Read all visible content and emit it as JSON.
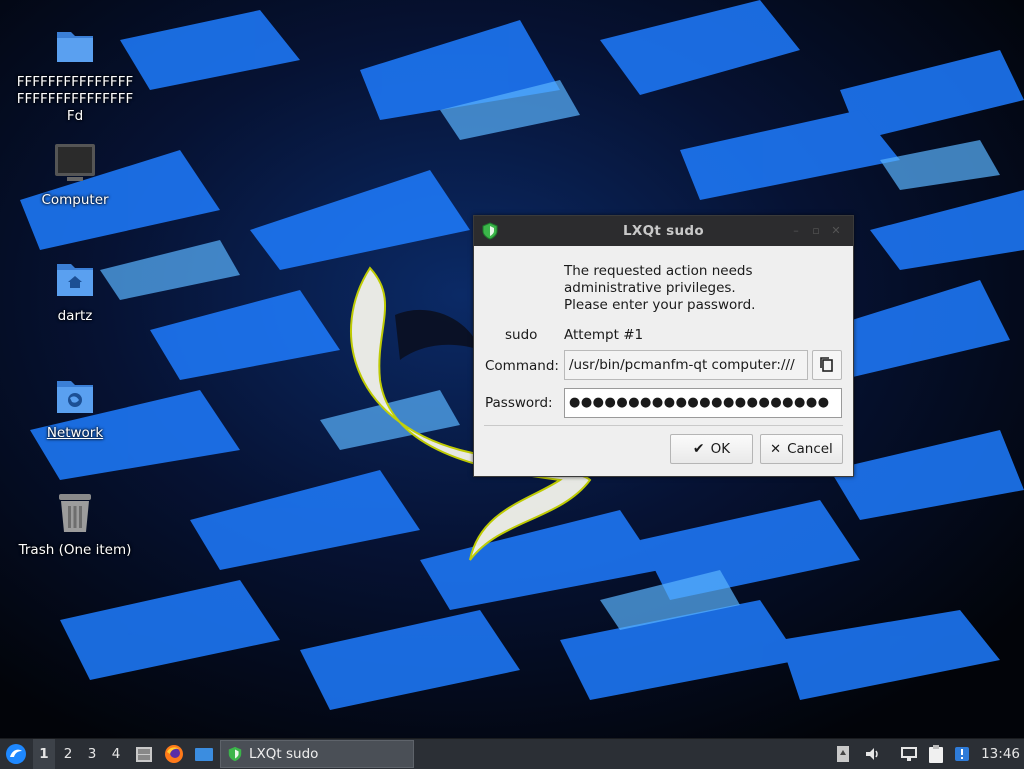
{
  "desktop": {
    "icons": [
      {
        "label": "FFFFFFFFFFFFFFFFFFFFFFFFFFFFFFFd",
        "icon": "folder-icon"
      },
      {
        "label": "Computer",
        "icon": "computer-icon"
      },
      {
        "label": "dartz",
        "icon": "home-folder-icon"
      },
      {
        "label": "Network",
        "icon": "network-folder-icon"
      },
      {
        "label": "Trash (One item)",
        "icon": "trash-icon"
      }
    ]
  },
  "dialog": {
    "title": "LXQt sudo",
    "message_line1": "The requested action needs",
    "message_line2": "administrative privileges.",
    "message_line3": "Please enter your password.",
    "sudo_label": "sudo",
    "attempt": "Attempt #1",
    "command_label": "Command:",
    "command_value": "/usr/bin/pcmanfm-qt computer:///",
    "password_label": "Password:",
    "password_mask": "●●●●●●●●●●●●●●●●●●●●●●",
    "ok_label": "OK",
    "cancel_label": "Cancel"
  },
  "taskbar": {
    "workspaces": [
      "1",
      "2",
      "3",
      "4"
    ],
    "active_workspace": "1",
    "task_label": "LXQt sudo",
    "clock": "13:46"
  },
  "colors": {
    "accent": "#1e88ff",
    "shield_green": "#3bb54a",
    "folder_blue": "#4a90e2"
  }
}
